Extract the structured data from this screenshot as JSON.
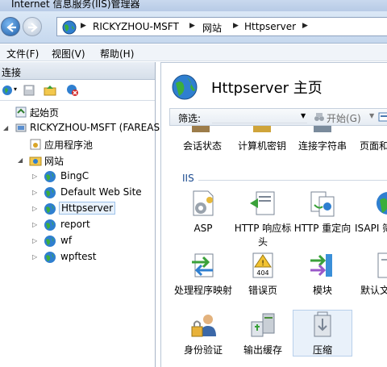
{
  "window": {
    "title": "Internet 信息服务(IIS)管理器"
  },
  "address": {
    "crumbs": [
      "RICKYZHOU-MSFT",
      "网站",
      "Httpserver"
    ],
    "separator": "▶"
  },
  "menu": {
    "items": [
      "文件(F)",
      "视图(V)",
      "帮助(H)"
    ]
  },
  "connections": {
    "header": "连接",
    "tree": [
      {
        "label": "起始页"
      },
      {
        "label": "RICKYZHOU-MSFT (FAREAS"
      },
      {
        "label": "应用程序池"
      },
      {
        "label": "网站"
      },
      {
        "label": "BingC"
      },
      {
        "label": "Default Web Site"
      },
      {
        "label": "Httpserver",
        "selected": true
      },
      {
        "label": "report"
      },
      {
        "label": "wf"
      },
      {
        "label": "wpftest"
      }
    ]
  },
  "main": {
    "title": "Httpserver 主页",
    "filter": {
      "label": "筛选:",
      "value": "",
      "start": "开始(G)"
    },
    "top_row": [
      "会话状态",
      "计算机密钥",
      "连接字符串",
      "页面和"
    ],
    "section": "IIS",
    "tiles": [
      {
        "label": "ASP",
        "icon": "asp-icon"
      },
      {
        "label": "HTTP 响应标头",
        "icon": "http-response-headers-icon"
      },
      {
        "label": "HTTP 重定向",
        "icon": "http-redirect-icon"
      },
      {
        "label": "ISAPI 筛",
        "icon": "isapi-icon"
      },
      {
        "label": "处理程序映射",
        "icon": "handler-mappings-icon"
      },
      {
        "label": "错误页",
        "icon": "error-pages-icon",
        "badge": "404"
      },
      {
        "label": "模块",
        "icon": "modules-icon"
      },
      {
        "label": "默认文",
        "icon": "default-document-icon"
      },
      {
        "label": "身份验证",
        "icon": "authentication-icon"
      },
      {
        "label": "输出缓存",
        "icon": "output-caching-icon"
      },
      {
        "label": "压缩",
        "icon": "compression-icon",
        "selected": true
      }
    ]
  }
}
